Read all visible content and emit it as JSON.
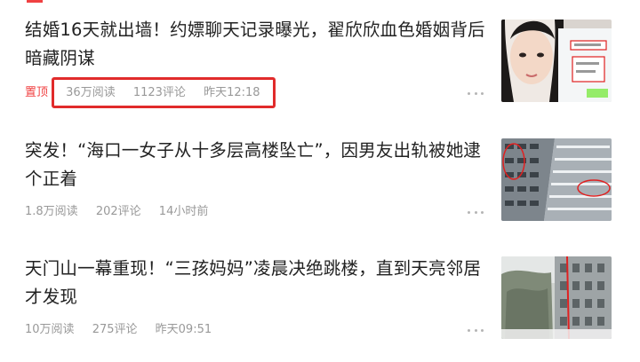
{
  "feed": {
    "items": [
      {
        "headline": "结婚16天就出墙！约嫖聊天记录曝光，翟欣欣血色婚姻背后暗藏阴谋",
        "pinned_label": "置顶",
        "reads": "36万阅读",
        "comments": "1123评论",
        "time": "昨天12:18",
        "more_icon": "more-icon",
        "thumbnail": "woman-portrait-with-chat-screenshot"
      },
      {
        "headline": "突发！“海口一女子从十多层高楼坠亡”，因男友出轨被她逮个正着",
        "reads": "1.8万阅读",
        "comments": "202评论",
        "time": "14小时前",
        "more_icon": "more-icon",
        "thumbnail": "high-rise-building-facade"
      },
      {
        "headline": "天门山一幕重现！“三孩妈妈”凌晨决绝跳楼，直到天亮邻居才发现",
        "reads": "10万阅读",
        "comments": "275评论",
        "time": "昨天09:51",
        "more_icon": "more-icon",
        "thumbnail": "apartment-building-and-tree"
      }
    ]
  },
  "colors": {
    "accent": "#f04142",
    "highlight_box": "#e12b2b",
    "meta_text": "#999999",
    "headline_text": "#222222"
  }
}
